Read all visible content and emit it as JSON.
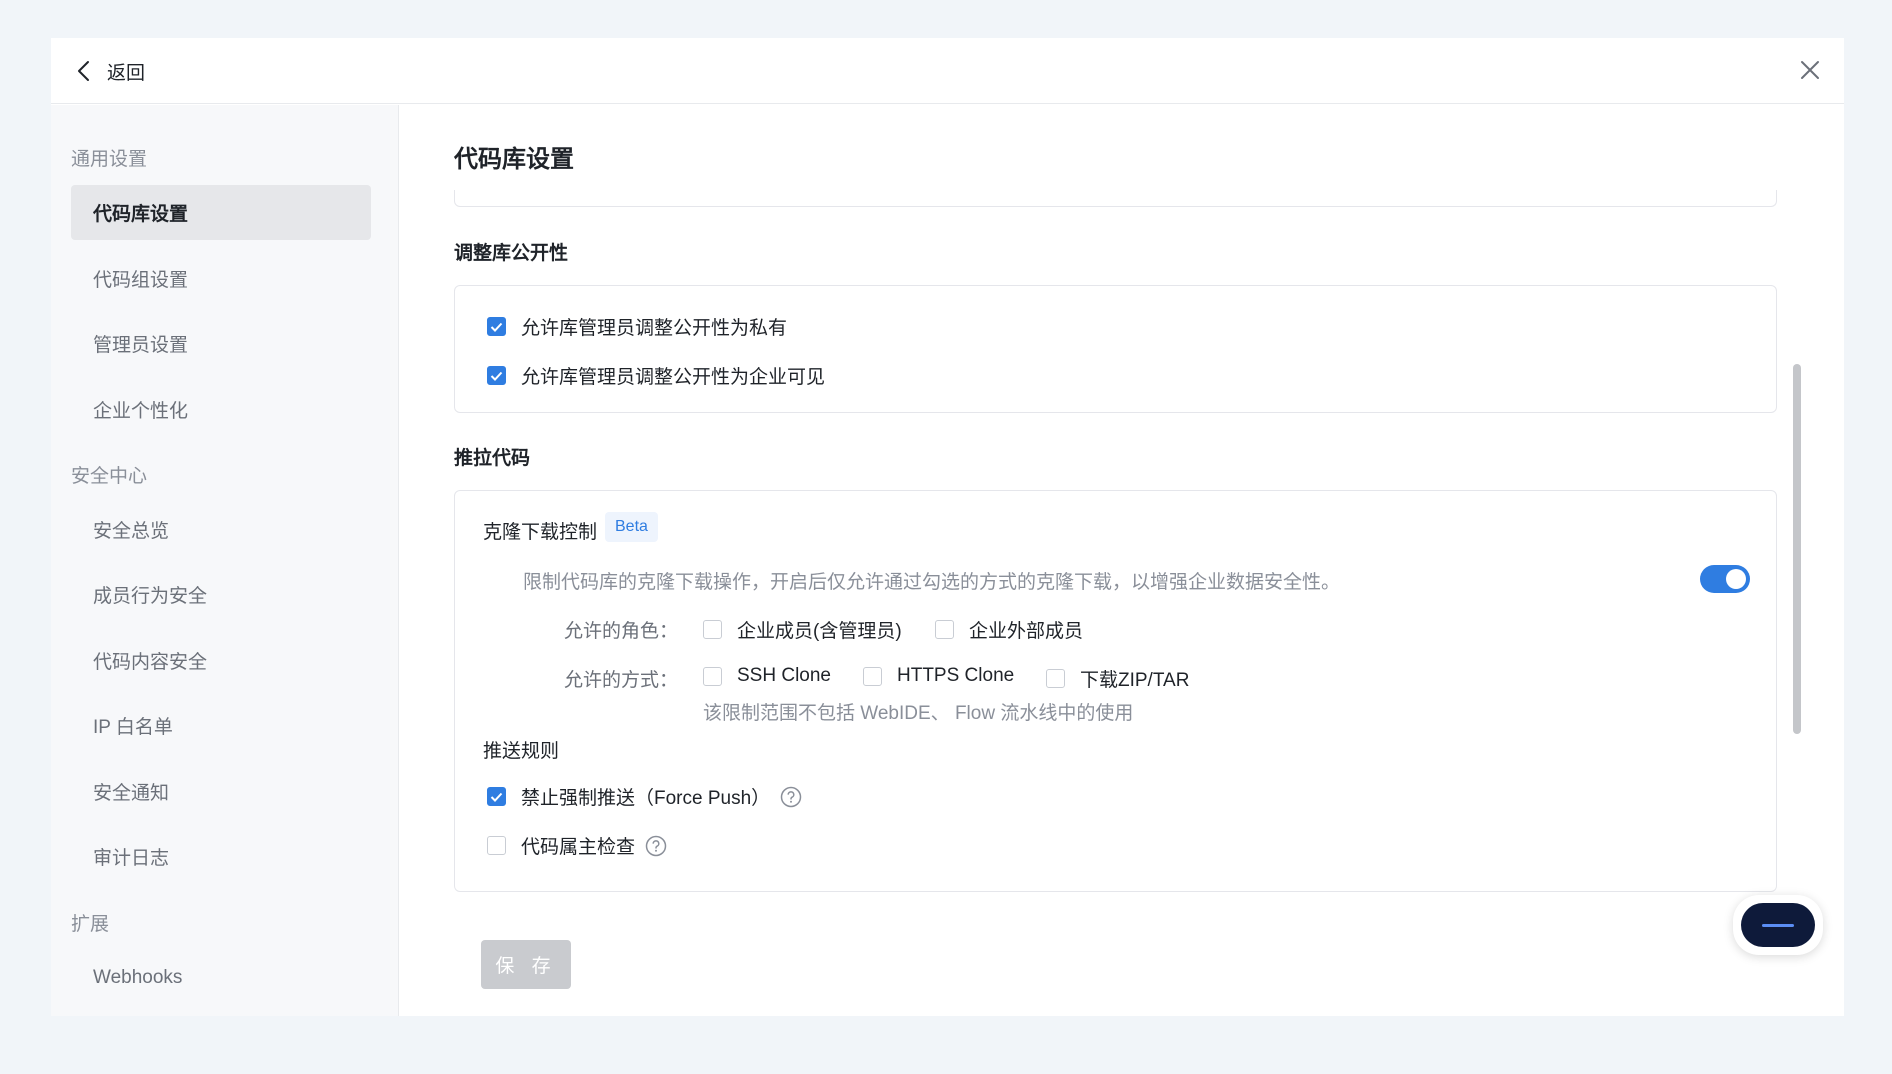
{
  "header": {
    "back_label": "返回"
  },
  "sidebar": {
    "groups": [
      {
        "title": "通用设置",
        "items": [
          "代码库设置",
          "代码组设置",
          "管理员设置",
          "企业个性化"
        ]
      },
      {
        "title": "安全中心",
        "items": [
          "安全总览",
          "成员行为安全",
          "代码内容安全",
          "IP 白名单",
          "安全通知",
          "审计日志"
        ]
      },
      {
        "title": "扩展",
        "items": [
          "Webhooks"
        ]
      }
    ],
    "active_item": "代码库设置"
  },
  "main": {
    "title": "代码库设置",
    "visibility": {
      "title": "调整库公开性",
      "options": [
        {
          "label": "允许库管理员调整公开性为私有",
          "checked": true
        },
        {
          "label": "允许库管理员调整公开性为企业可见",
          "checked": true
        }
      ]
    },
    "push_pull": {
      "title": "推拉代码",
      "clone_control": {
        "title": "克隆下载控制",
        "badge": "Beta",
        "description": "限制代码库的克隆下载操作，开启后仅允许通过勾选的方式的克隆下载，以增强企业数据安全性。",
        "enabled": true,
        "roles_label": "允许的角色：",
        "roles": [
          {
            "label": "企业成员(含管理员)",
            "checked": false
          },
          {
            "label": "企业外部成员",
            "checked": false
          }
        ],
        "methods_label": "允许的方式：",
        "methods": [
          {
            "label": "SSH Clone",
            "checked": false
          },
          {
            "label": "HTTPS Clone",
            "checked": false
          },
          {
            "label": "下载ZIP/TAR",
            "checked": false
          }
        ],
        "hint": "该限制范围不包括 WebIDE、 Flow 流水线中的使用"
      },
      "push_rules": {
        "title": "推送规则",
        "options": [
          {
            "label": "禁止强制推送（Force Push）",
            "checked": true
          },
          {
            "label": "代码属主检查",
            "checked": false
          }
        ]
      }
    },
    "save_label": "保 存"
  },
  "colors": {
    "accent": "#2f7de1",
    "sidebar_bg": "#f7f8fa",
    "active_bg": "#e6e7ea",
    "disabled_button": "#c9cbcf"
  }
}
